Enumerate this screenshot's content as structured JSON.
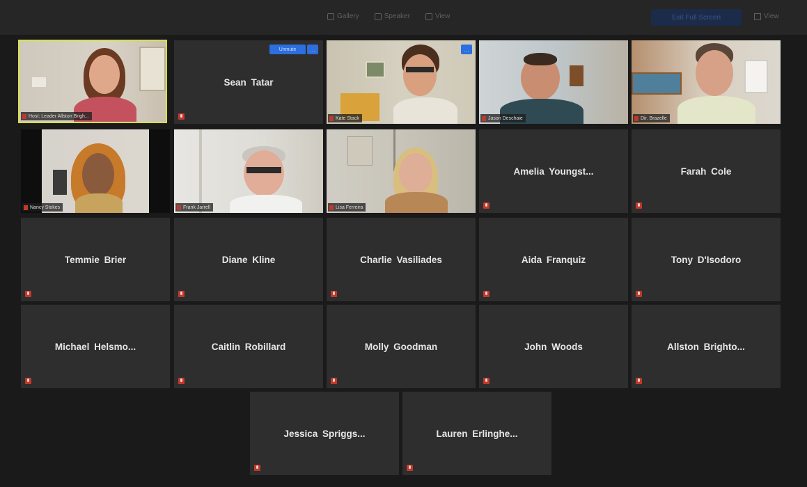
{
  "toolbar": {
    "items": [
      {
        "icon": "grid-icon",
        "label": "Gallery"
      },
      {
        "icon": "users-icon",
        "label": "Speaker"
      },
      {
        "icon": "view-icon",
        "label": "View"
      }
    ],
    "primary_button": "Exit Full Screen",
    "right_label": "View"
  },
  "tiles": [
    {
      "name": "",
      "caption": "Host: Leader Allston Brigh...",
      "video": true,
      "active": true
    },
    {
      "name": "Sean Tatar",
      "caption": "",
      "video": false,
      "unmute": "Unmute",
      "more": "…"
    },
    {
      "name": "",
      "caption": "Kate Stack",
      "video": true,
      "more": "…"
    },
    {
      "name": "",
      "caption": "Jason Deschaie",
      "video": true
    },
    {
      "name": "",
      "caption": "Dir. Brazelle",
      "video": true
    },
    {
      "name": "",
      "caption": "Nancy Stokes",
      "video": true
    },
    {
      "name": "",
      "caption": "Frank Jarrell",
      "video": true
    },
    {
      "name": "",
      "caption": "Lisa Ferreira",
      "video": true
    },
    {
      "name": "Amelia  Youngst...",
      "video": false
    },
    {
      "name": "Farah Cole",
      "video": false
    },
    {
      "name": "Temmie Brier",
      "video": false
    },
    {
      "name": "Diane Kline",
      "video": false
    },
    {
      "name": "Charlie Vasiliades",
      "video": false
    },
    {
      "name": "Aida Franquiz",
      "video": false
    },
    {
      "name": "Tony D'Isodoro",
      "video": false
    },
    {
      "name": "Michael  Helsmo...",
      "video": false
    },
    {
      "name": "Caitlin Robillard",
      "video": false
    },
    {
      "name": "Molly Goodman",
      "video": false
    },
    {
      "name": "John Woods",
      "video": false
    },
    {
      "name": "Allston  Brighto...",
      "video": false
    },
    {
      "name": "Jessica  Spriggs...",
      "video": false
    },
    {
      "name": "Lauren  Erlinghe...",
      "video": false
    }
  ]
}
